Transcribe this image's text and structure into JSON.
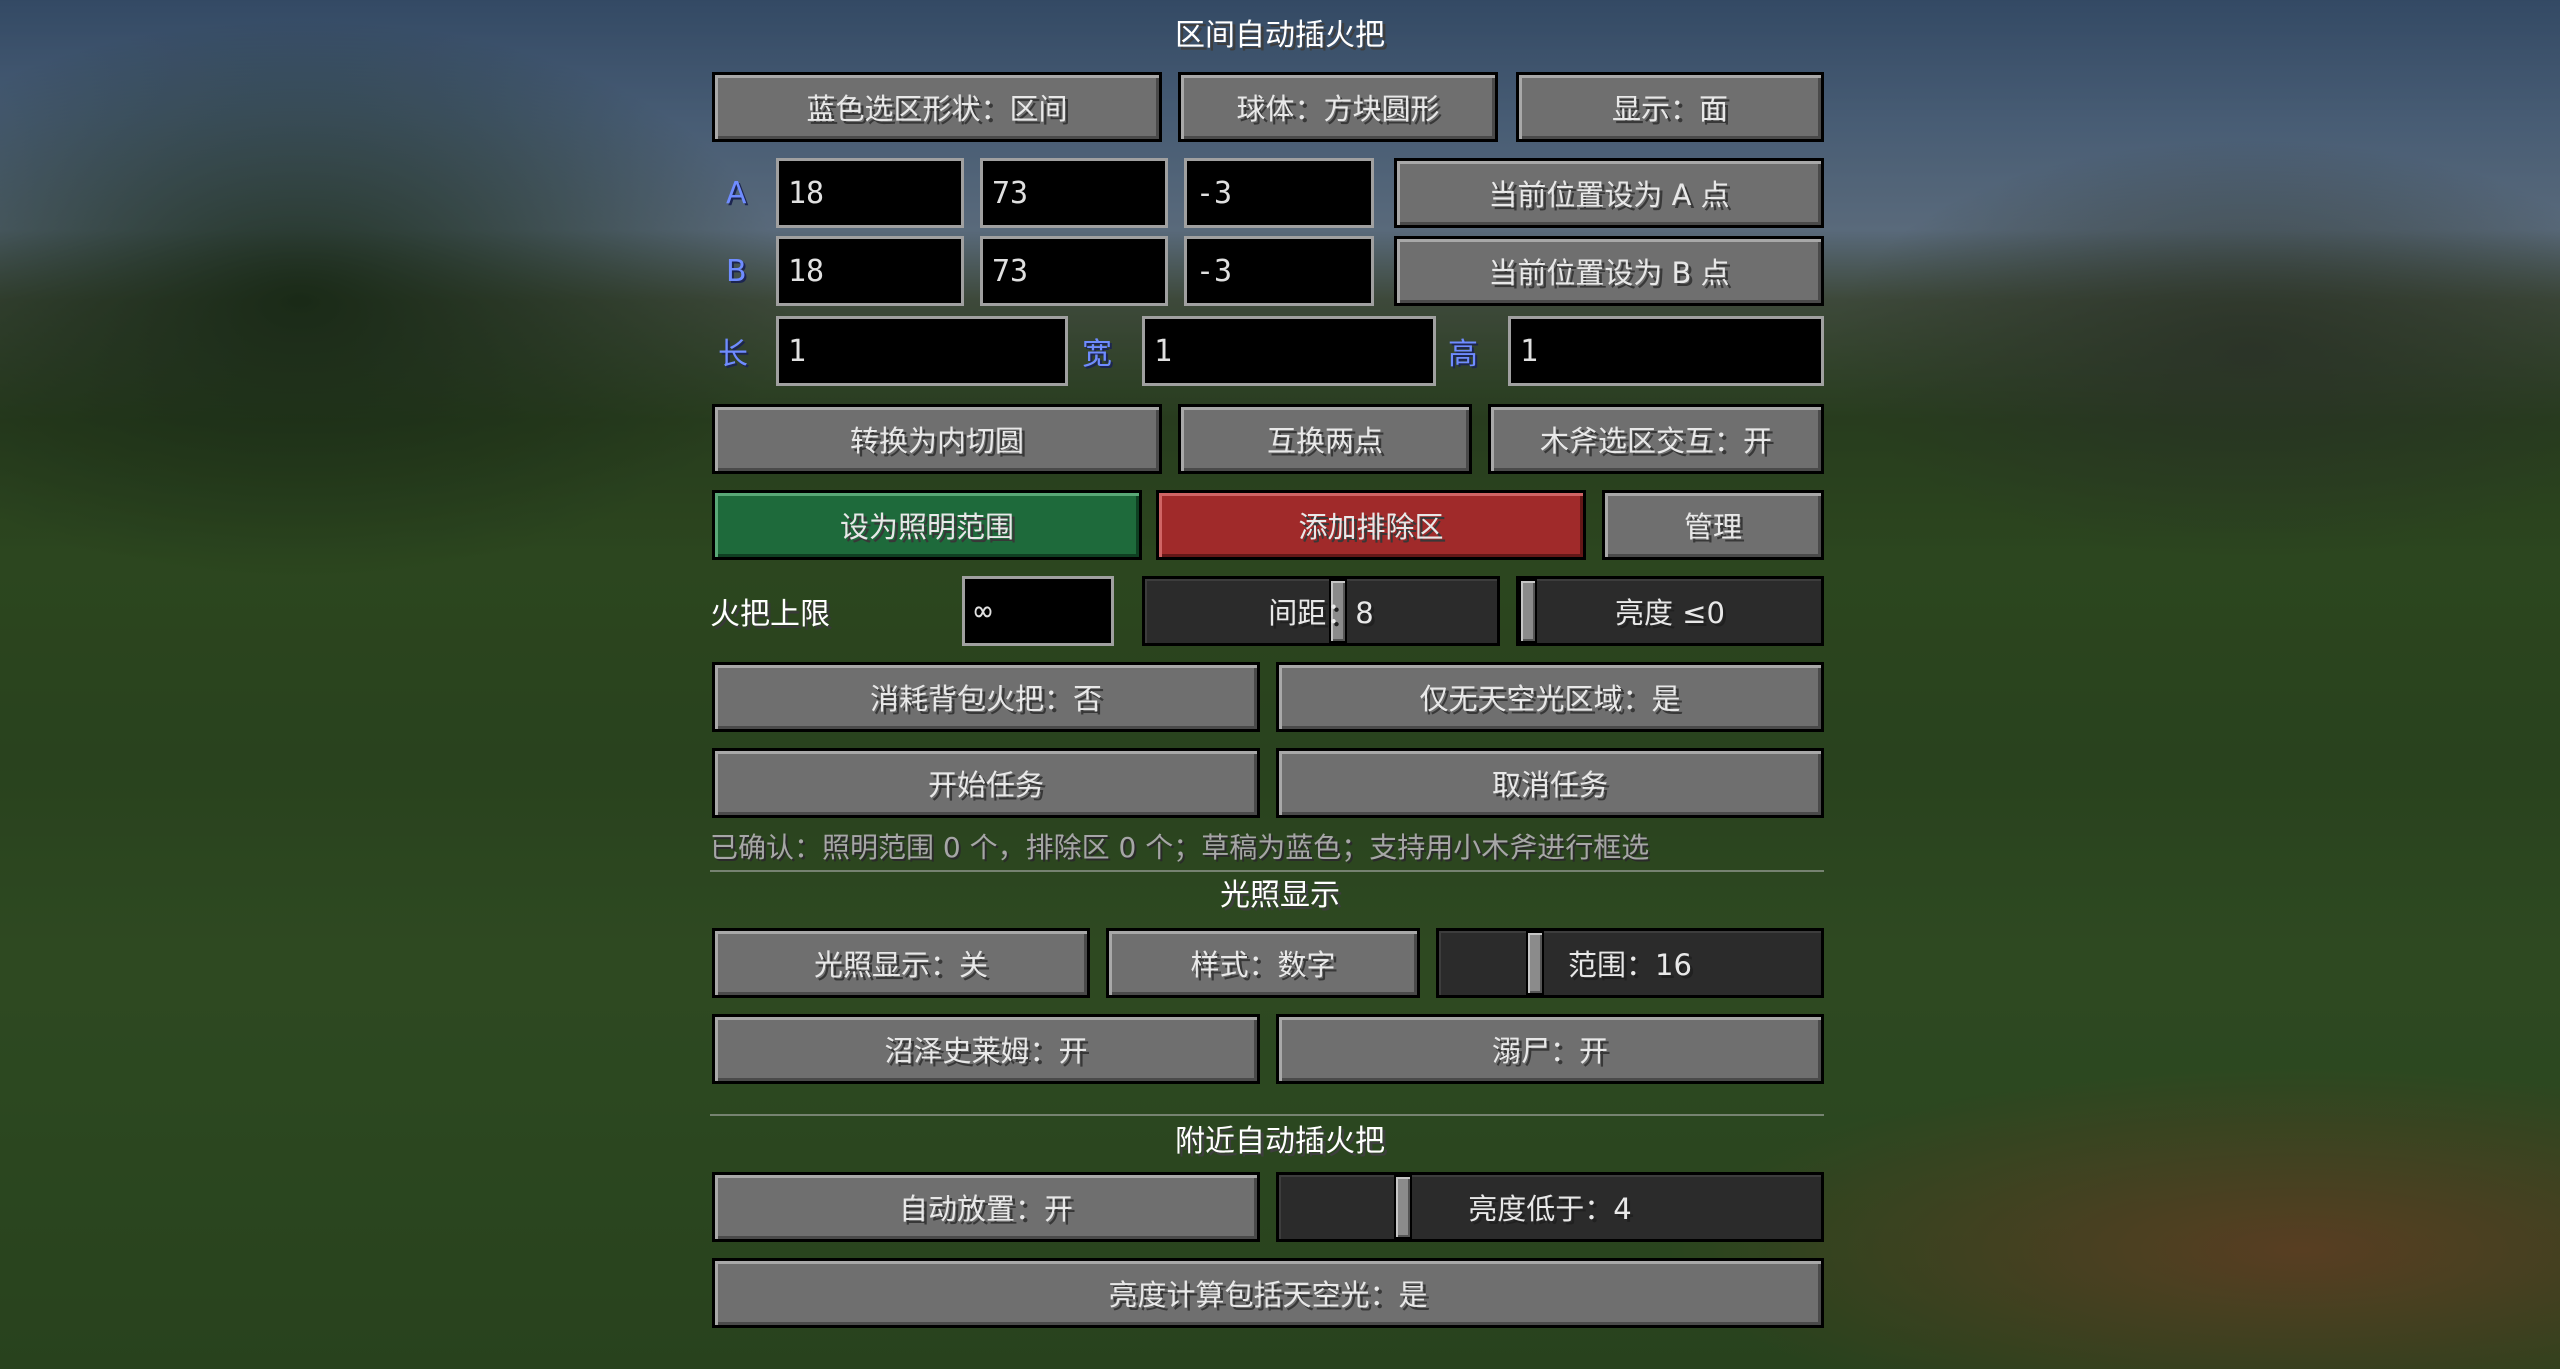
{
  "section_titles": {
    "area_torch": "区间自动插火把",
    "light_display": "光照显示",
    "nearby_torch": "附近自动插火把"
  },
  "selection": {
    "shape_button": "蓝色选区形状：区间",
    "sphere_button": "球体：方块圆形",
    "display_button": "显示：面"
  },
  "point_a": {
    "label": "A",
    "x": "18",
    "y": "73",
    "z": "-3",
    "set_button": "当前位置设为 A 点"
  },
  "point_b": {
    "label": "B",
    "x": "18",
    "y": "73",
    "z": "-3",
    "set_button": "当前位置设为 B 点"
  },
  "dimensions": {
    "length_label": "长",
    "length_value": "1",
    "width_label": "宽",
    "width_value": "1",
    "height_label": "高",
    "height_value": "1"
  },
  "actions": {
    "inscribe_button": "转换为内切圆",
    "swap_button": "互换两点",
    "axe_button": "木斧选区交互：开",
    "set_light_button": "设为照明范围",
    "add_exclude_button": "添加排除区",
    "manage_button": "管理"
  },
  "torch_limit": {
    "label": "火把上限",
    "value": "∞"
  },
  "spacing_slider": {
    "label": "间距：8",
    "value": 8,
    "fraction": 0.55
  },
  "brightness_slider": {
    "label": "亮度 ≤0",
    "value": 0,
    "fraction": 0.0
  },
  "options": {
    "consume_button": "消耗背包火把：否",
    "sky_only_button": "仅无天空光区域：是",
    "start_button": "开始任务",
    "cancel_button": "取消任务"
  },
  "status_text": "已确认：照明范围 0 个，排除区 0 个；草稿为蓝色；支持用小木斧进行框选",
  "light": {
    "toggle_button": "光照显示：关",
    "style_button": "样式：数字",
    "range_slider": {
      "label": "范围：16",
      "value": 16,
      "fraction": 0.24
    },
    "slime_button": "沼泽史莱姆：开",
    "drowned_button": "溺尸：开"
  },
  "nearby": {
    "auto_button": "自动放置：开",
    "threshold_slider": {
      "label": "亮度低于：4",
      "value": 4,
      "fraction": 0.22
    },
    "include_sky_button": "亮度计算包括天空光：是"
  },
  "colors": {
    "green_button": "#1e6a3b",
    "red_button": "#a02a2a",
    "axis_label": "#6f8cff"
  }
}
